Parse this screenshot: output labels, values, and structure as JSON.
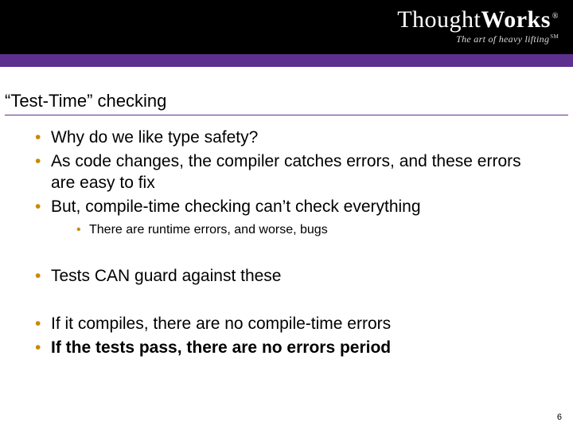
{
  "logo": {
    "main_a": "Thought",
    "main_b": "Works",
    "reg": "®",
    "tagline": "The art of heavy lifting",
    "sm": "SM"
  },
  "title": "“Test-Time” checking",
  "bullets": {
    "b1": "Why do we like type safety?",
    "b2": "As code changes, the compiler catches errors, and these errors are easy to fix",
    "b3": "But, compile-time checking can’t check everything",
    "b3a": "There are runtime errors, and worse, bugs",
    "b4": "Tests CAN guard against these",
    "b5": "If it compiles, there are no compile-time errors",
    "b6": "If the tests pass, there are no errors period"
  },
  "page_number": "6"
}
